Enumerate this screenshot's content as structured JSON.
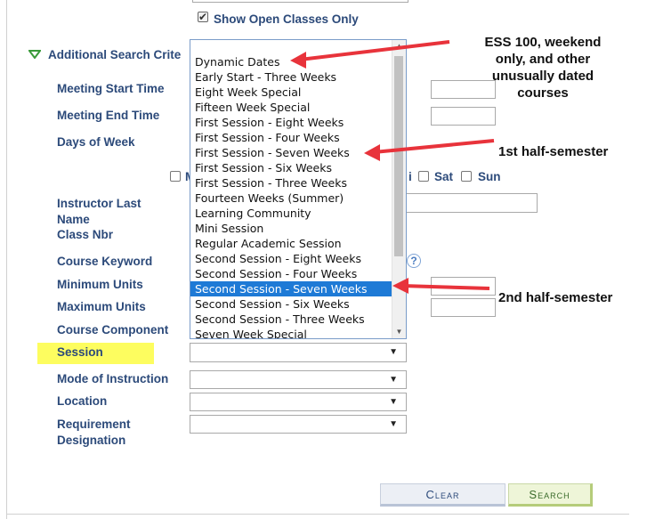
{
  "search": {
    "show_open_classes_label": "Show Open Classes Only",
    "additional_criteria_label": "Additional Search Crite",
    "fields": {
      "meeting_start_time": "Meeting Start Time",
      "meeting_end_time": "Meeting End Time",
      "days_of_week": "Days of Week",
      "instructor_last_name": "Instructor Last Name",
      "class_nbr": "Class Nbr",
      "course_keyword": "Course Keyword",
      "minimum_units": "Minimum Units",
      "maximum_units": "Maximum Units",
      "course_component": "Course Component",
      "session": "Session",
      "mode_of_instruction": "Mode of Instruction",
      "location": "Location",
      "requirement_designation": "Requirement Designation"
    },
    "days": {
      "monday_partial": "M",
      "friday_partial": "i",
      "saturday": "Sat",
      "sunday": "Sun"
    },
    "help_glyph": "?"
  },
  "session_dropdown": {
    "selected": "Second Session - Seven Weeks",
    "options": [
      "Dynamic Dates",
      "Early Start - Three Weeks",
      "Eight Week Special",
      "Fifteen Week Special",
      "First Session - Eight Weeks",
      "First Session - Four Weeks",
      "First Session - Seven Weeks",
      "First Session - Six Weeks",
      "First Session - Three Weeks",
      "Fourteen Weeks (Summer)",
      "Learning Community",
      "Mini Session",
      "Regular Academic Session",
      "Second Session - Eight Weeks",
      "Second Session - Four Weeks",
      "Second Session - Seven Weeks",
      "Second Session - Six Weeks",
      "Second Session - Three Weeks",
      "Seven Week Special"
    ]
  },
  "annotations": {
    "dynamic_dates_note": [
      "ESS 100, weekend",
      "only, and other",
      "unusually dated",
      "courses"
    ],
    "first_half": "1st half-semester",
    "second_half": "2nd half-semester"
  },
  "buttons": {
    "clear": "Clear",
    "search": "Search"
  },
  "colors": {
    "label_blue": "#2c4a7a",
    "highlight_yellow": "#fdfd5f",
    "selected_blue": "#1e7ad6",
    "arrow_red": "#e8333b",
    "triangle_green": "#3a9a3a"
  }
}
